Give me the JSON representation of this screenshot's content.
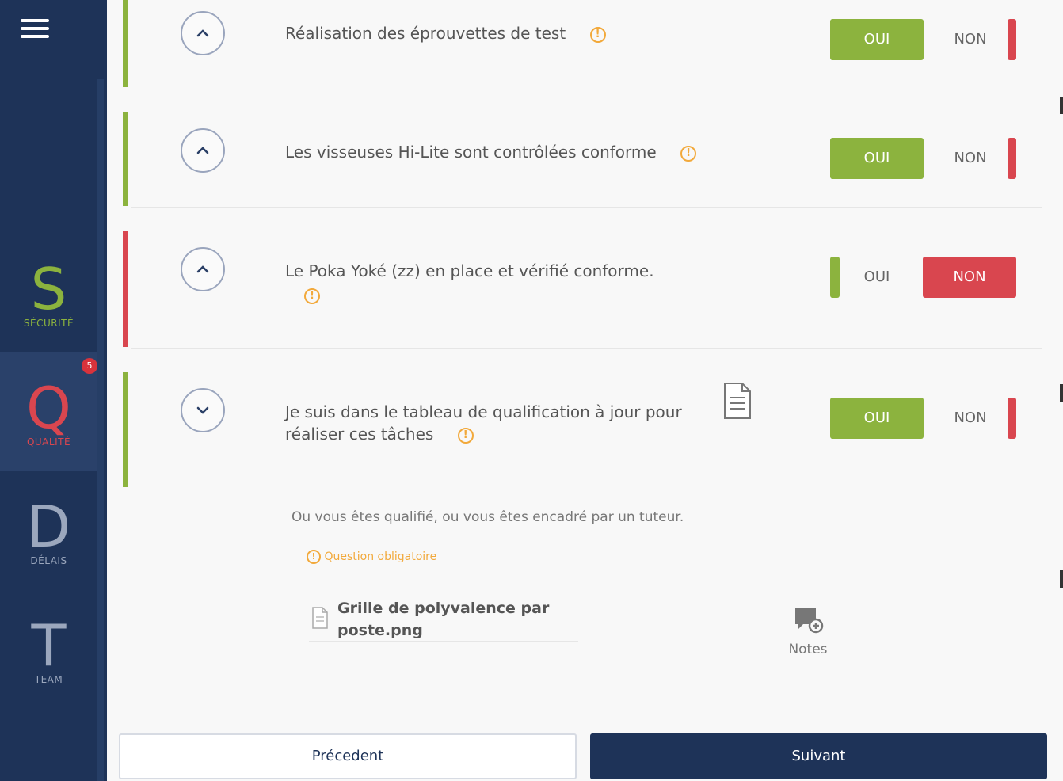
{
  "sidebar": {
    "items": [
      {
        "letter": "S",
        "caption": "SÉCURITÉ"
      },
      {
        "letter": "Q",
        "caption": "QUALITÉ",
        "badge": "5"
      },
      {
        "letter": "D",
        "caption": "DÉLAIS"
      },
      {
        "letter": "T",
        "caption": "TEAM"
      }
    ]
  },
  "questions": [
    {
      "text": "Réalisation des éprouvettes de test",
      "oui": "OUI",
      "non": "NON",
      "status": "oui"
    },
    {
      "text": "Les visseuses Hi-Lite sont contrôlées conforme",
      "oui": "OUI",
      "non": "NON",
      "status": "oui"
    },
    {
      "text": "Le Poka Yoké (zz) en place et vérifié conforme.",
      "oui": "OUI",
      "non": "NON",
      "status": "non"
    },
    {
      "text_line1": "Je suis dans le tableau de qualification à jour pour",
      "text_line2": "réaliser ces tâches",
      "oui": "OUI",
      "non": "NON",
      "status": "oui",
      "comment": "Ou vous êtes qualifié, ou vous êtes encadré par un tuteur.",
      "mandatory": "Question obligatoire",
      "attachment_line1": "Grille de polyvalence par",
      "attachment_line2": "poste.png",
      "notes_label": "Notes"
    }
  ],
  "footer": {
    "prev_label": "Précedent",
    "next_label": "Suivant"
  },
  "colors": {
    "sidebar_bg": "#1e3358",
    "green": "#8cb33e",
    "red": "#d9464f",
    "warning": "#f2a93b"
  }
}
